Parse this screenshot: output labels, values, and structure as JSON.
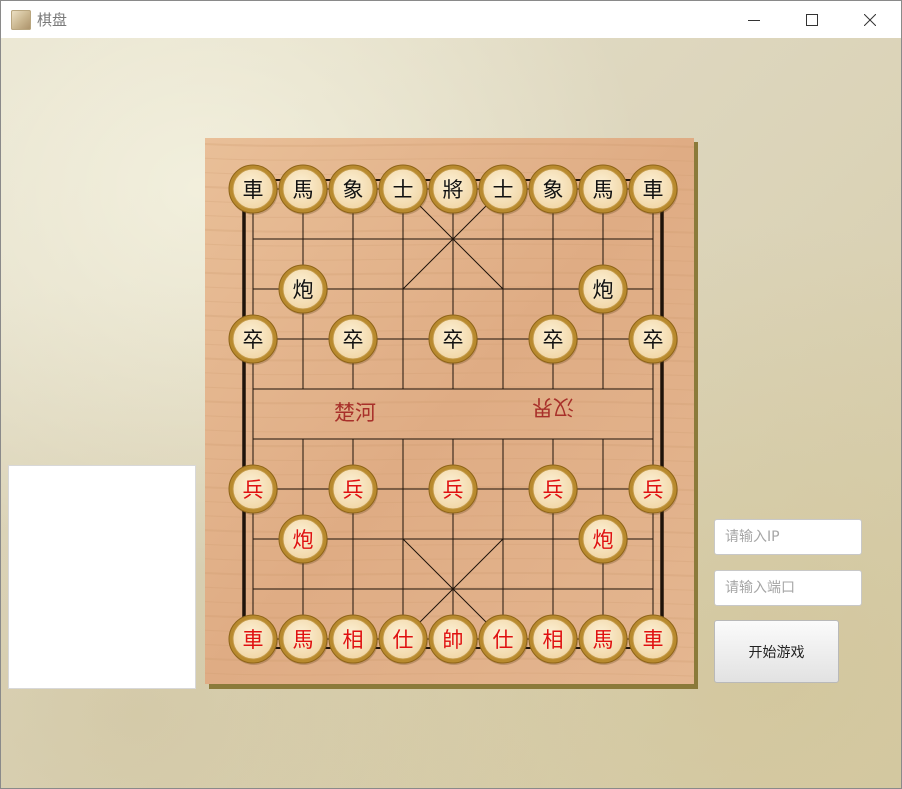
{
  "window": {
    "title": "棋盘"
  },
  "board": {
    "river_left": "楚河",
    "river_right": "汉界",
    "black_pieces": [
      {
        "char": "車",
        "col": 0,
        "row": 0
      },
      {
        "char": "馬",
        "col": 1,
        "row": 0
      },
      {
        "char": "象",
        "col": 2,
        "row": 0
      },
      {
        "char": "士",
        "col": 3,
        "row": 0
      },
      {
        "char": "將",
        "col": 4,
        "row": 0
      },
      {
        "char": "士",
        "col": 5,
        "row": 0
      },
      {
        "char": "象",
        "col": 6,
        "row": 0
      },
      {
        "char": "馬",
        "col": 7,
        "row": 0
      },
      {
        "char": "車",
        "col": 8,
        "row": 0
      },
      {
        "char": "炮",
        "col": 1,
        "row": 2
      },
      {
        "char": "炮",
        "col": 7,
        "row": 2
      },
      {
        "char": "卒",
        "col": 0,
        "row": 3
      },
      {
        "char": "卒",
        "col": 2,
        "row": 3
      },
      {
        "char": "卒",
        "col": 4,
        "row": 3
      },
      {
        "char": "卒",
        "col": 6,
        "row": 3
      },
      {
        "char": "卒",
        "col": 8,
        "row": 3
      }
    ],
    "red_pieces": [
      {
        "char": "兵",
        "col": 0,
        "row": 6
      },
      {
        "char": "兵",
        "col": 2,
        "row": 6
      },
      {
        "char": "兵",
        "col": 4,
        "row": 6
      },
      {
        "char": "兵",
        "col": 6,
        "row": 6
      },
      {
        "char": "兵",
        "col": 8,
        "row": 6
      },
      {
        "char": "炮",
        "col": 1,
        "row": 7
      },
      {
        "char": "炮",
        "col": 7,
        "row": 7
      },
      {
        "char": "車",
        "col": 0,
        "row": 9
      },
      {
        "char": "馬",
        "col": 1,
        "row": 9
      },
      {
        "char": "相",
        "col": 2,
        "row": 9
      },
      {
        "char": "仕",
        "col": 3,
        "row": 9
      },
      {
        "char": "帥",
        "col": 4,
        "row": 9
      },
      {
        "char": "仕",
        "col": 5,
        "row": 9
      },
      {
        "char": "相",
        "col": 6,
        "row": 9
      },
      {
        "char": "馬",
        "col": 7,
        "row": 9
      },
      {
        "char": "車",
        "col": 8,
        "row": 9
      }
    ]
  },
  "controls": {
    "ip_placeholder": "请输入IP",
    "port_placeholder": "请输入端口",
    "start_button": "开始游戏"
  },
  "colors": {
    "black_piece_text": "#111111",
    "red_piece_text": "#e01010",
    "river_text": "#a8302a"
  }
}
